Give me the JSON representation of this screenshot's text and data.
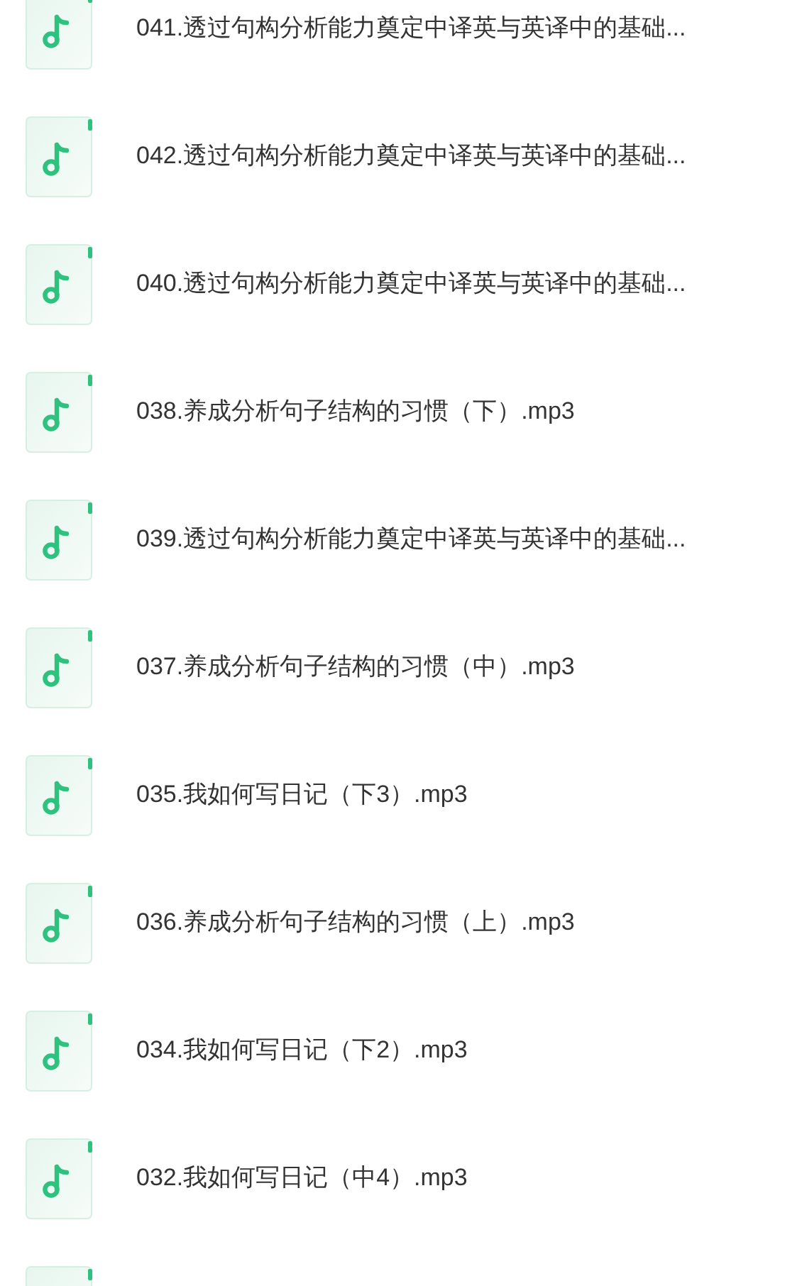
{
  "files": [
    {
      "kind": "audio",
      "title": "041.透过句构分析能力奠定中译英与英译中的基础..."
    },
    {
      "kind": "audio",
      "title": "042.透过句构分析能力奠定中译英与英译中的基础..."
    },
    {
      "kind": "audio",
      "title": "040.透过句构分析能力奠定中译英与英译中的基础..."
    },
    {
      "kind": "audio",
      "title": "038.养成分析句子结构的习惯（下）.mp3"
    },
    {
      "kind": "audio",
      "title": "039.透过句构分析能力奠定中译英与英译中的基础..."
    },
    {
      "kind": "audio",
      "title": "037.养成分析句子结构的习惯（中）.mp3"
    },
    {
      "kind": "audio",
      "title": "035.我如何写日记（下3）.mp3"
    },
    {
      "kind": "audio",
      "title": "036.养成分析句子结构的习惯（上）.mp3"
    },
    {
      "kind": "audio",
      "title": "034.我如何写日记（下2）.mp3"
    },
    {
      "kind": "audio",
      "title": "032.我如何写日记（中4）.mp3"
    },
    {
      "kind": "audio"
    }
  ]
}
